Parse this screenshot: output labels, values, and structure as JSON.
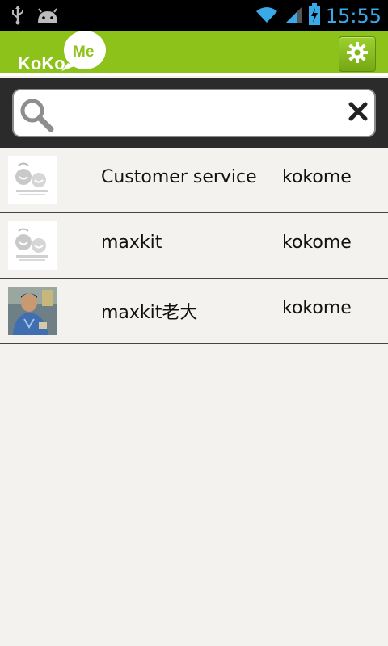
{
  "status_bar": {
    "time": "15:55",
    "icons": [
      "usb-icon",
      "android-debug-icon",
      "wifi-icon",
      "signal-icon",
      "battery-charging-icon"
    ]
  },
  "app_bar": {
    "logo_text_left": "KoKo",
    "logo_text_bubble": "Me",
    "settings_icon": "gear-icon",
    "accent_color": "#8cc21a"
  },
  "search": {
    "value": "",
    "placeholder": "",
    "search_icon": "magnifier-icon",
    "clear_icon": "close-icon"
  },
  "contacts": [
    {
      "name": "Customer service",
      "account": "kokome",
      "avatar": "kokome-logo-avatar"
    },
    {
      "name": "maxkit",
      "account": "kokome",
      "avatar": "kokome-logo-avatar"
    },
    {
      "name": "maxkit老大",
      "account": "kokome",
      "avatar": "photo-avatar"
    }
  ]
}
